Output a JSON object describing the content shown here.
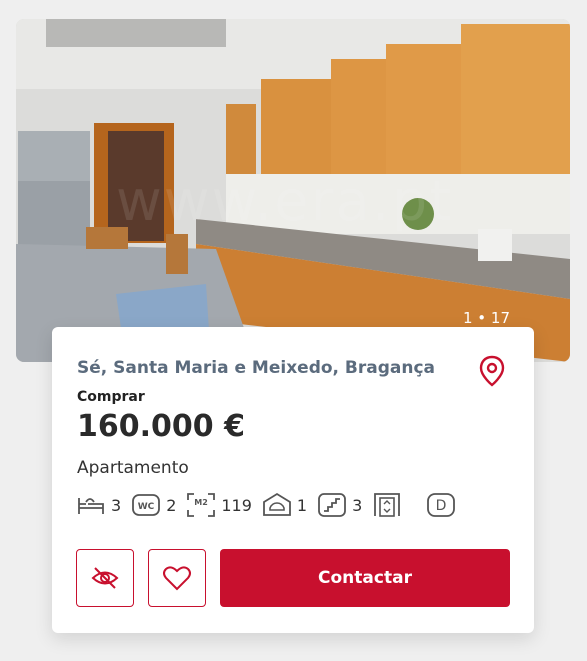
{
  "gallery": {
    "counter": "1 • 17",
    "watermark": "www.era.pt"
  },
  "listing": {
    "location": "Sé, Santa Maria e Meixedo, Bragança",
    "deal_type": "Comprar",
    "price": "160.000 €",
    "property_type": "Apartamento",
    "features": {
      "bedrooms": "3",
      "bathrooms": "2",
      "area": "119",
      "garage": "1",
      "floor": "3",
      "energy_class": "D"
    }
  },
  "actions": {
    "contact_label": "Contactar"
  },
  "colors": {
    "accent": "#c8102e",
    "location_text": "#5b6b7d"
  }
}
